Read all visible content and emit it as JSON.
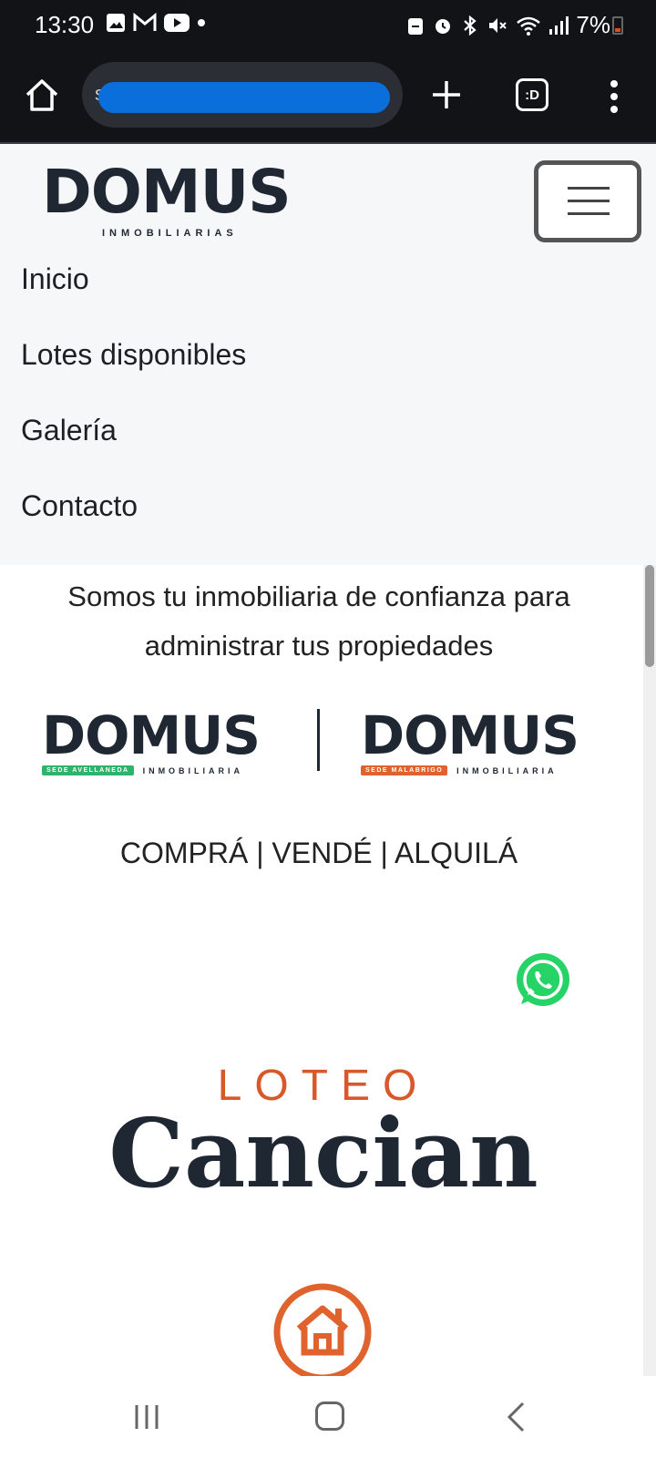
{
  "status_bar": {
    "time": "13:30",
    "battery": "7%",
    "left_icons": [
      "image-icon",
      "gmail-icon",
      "youtube-icon",
      "dot-icon"
    ],
    "right_icons": [
      "lock-icon",
      "alarm-icon",
      "bluetooth-icon",
      "mute-icon",
      "wifi-icon",
      "signal-icon",
      "battery-icon"
    ]
  },
  "browser": {
    "url_visible_char": "s",
    "tab_count_label": ":D"
  },
  "site": {
    "logo_main": "DOMUS",
    "logo_sub": "INMOBILIARIAS",
    "nav": [
      "Inicio",
      "Lotes disponibles",
      "Galería",
      "Contacto"
    ]
  },
  "main": {
    "tagline": "Somos tu inmobiliaria de confianza para administrar tus propiedades",
    "brands": [
      {
        "name": "DOMUS",
        "sede": "SEDE AVELLANEDA",
        "inmo": "INMOBILIARIA",
        "color": "#2fb36b"
      },
      {
        "name": "DOMUS",
        "sede": "SEDE MALABRIGO",
        "inmo": "INMOBILIARIA",
        "color": "#e0632e"
      }
    ],
    "services": "COMPRÁ | VENDÉ | ALQUILÁ",
    "loteo_small": "LOTEO",
    "loteo_big": "Cancian"
  },
  "colors": {
    "accent_orange": "#d8582a",
    "dark_navy": "#1f2733",
    "whatsapp_green": "#25d366",
    "url_redaction": "#0a6fdb"
  }
}
